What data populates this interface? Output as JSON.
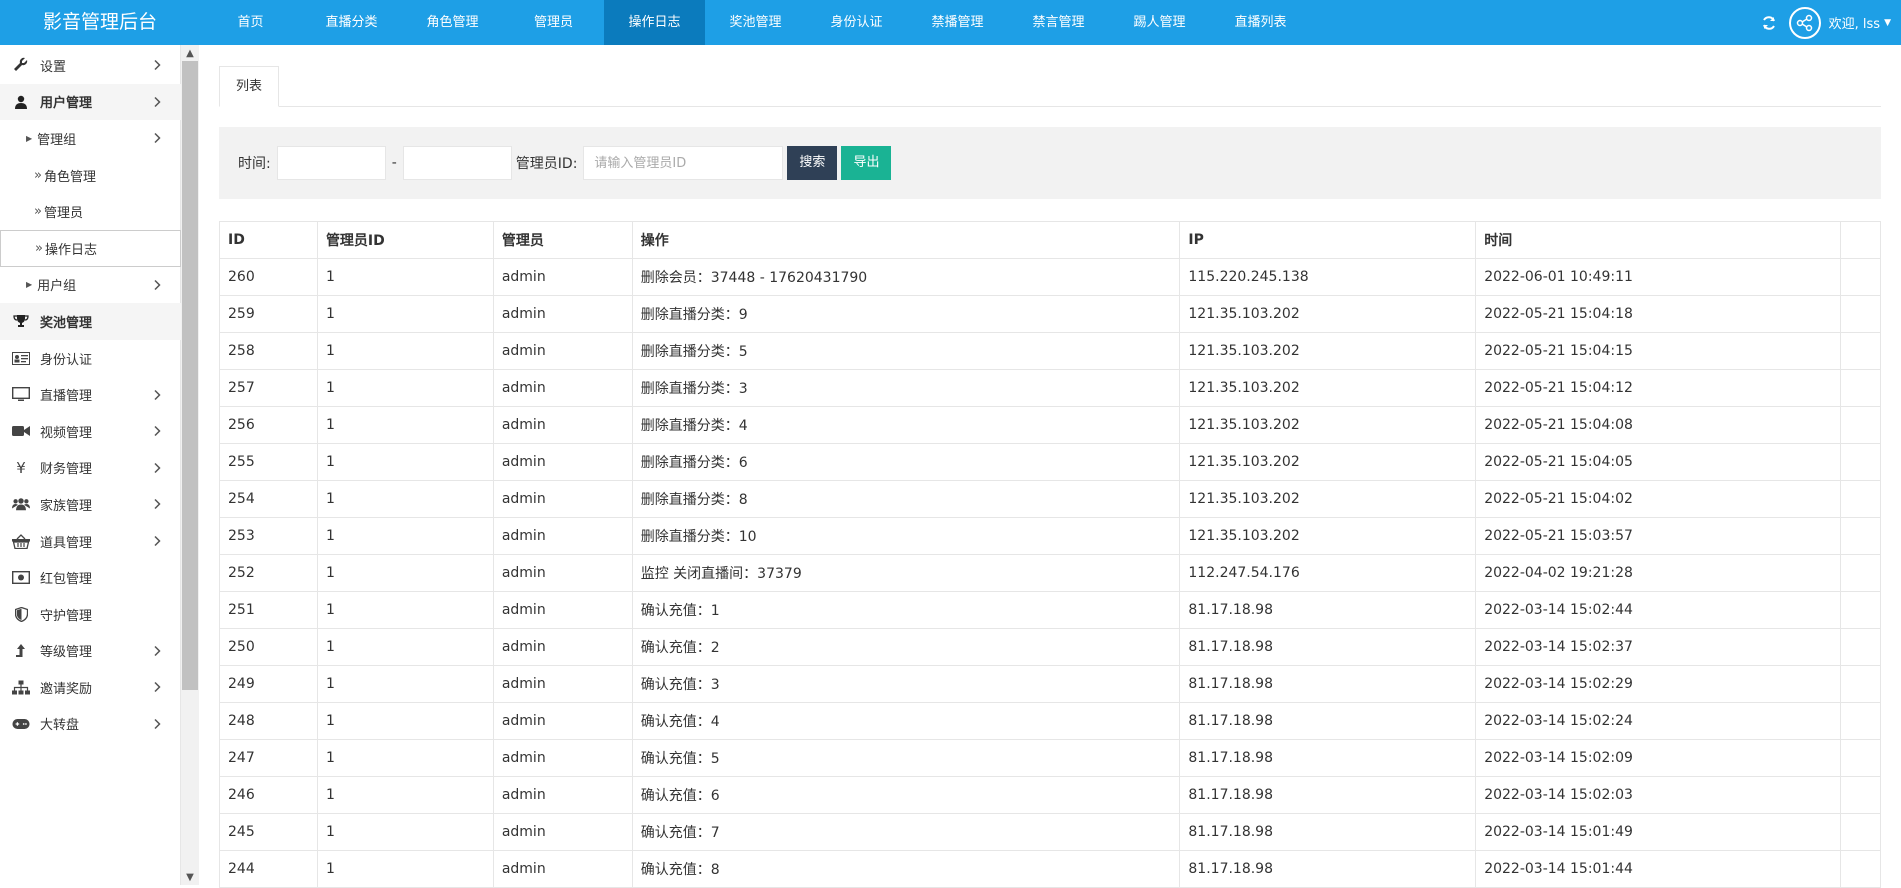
{
  "app": {
    "title": "影音管理后台"
  },
  "topnav": [
    {
      "label": "首页",
      "active": false
    },
    {
      "label": "直播分类",
      "active": false
    },
    {
      "label": "角色管理",
      "active": false
    },
    {
      "label": "管理员",
      "active": false
    },
    {
      "label": "操作日志",
      "active": true
    },
    {
      "label": "奖池管理",
      "active": false
    },
    {
      "label": "身份认证",
      "active": false
    },
    {
      "label": "禁播管理",
      "active": false
    },
    {
      "label": "禁言管理",
      "active": false
    },
    {
      "label": "踢人管理",
      "active": false
    },
    {
      "label": "直播列表",
      "active": false
    }
  ],
  "header": {
    "welcome": "欢迎, lss",
    "refresh_icon": "refresh-icon",
    "avatar_icon": "share-icon"
  },
  "colors": {
    "topbar": "#1e9fe6",
    "active_nav": "#0b7bbd",
    "search_btn": "#2f4056",
    "export_btn": "#1ab394"
  },
  "sidebar": [
    {
      "label": "设置",
      "icon": "wrench-icon",
      "arrow": true,
      "level": 0
    },
    {
      "label": "用户管理",
      "icon": "user-icon",
      "arrow": true,
      "level": 0,
      "bold": true
    },
    {
      "label": "管理组",
      "icon": "triangle",
      "arrow": true,
      "level": 1
    },
    {
      "label": "角色管理",
      "icon": "double-arrow",
      "arrow": false,
      "level": 2
    },
    {
      "label": "管理员",
      "icon": "double-arrow",
      "arrow": false,
      "level": 2
    },
    {
      "label": "操作日志",
      "icon": "double-arrow",
      "arrow": false,
      "level": 2,
      "selected": true
    },
    {
      "label": "用户组",
      "icon": "triangle",
      "arrow": true,
      "level": 1
    },
    {
      "label": "奖池管理",
      "icon": "trophy-icon",
      "arrow": false,
      "level": 0,
      "bold": true
    },
    {
      "label": "身份认证",
      "icon": "id-card-icon",
      "arrow": false,
      "level": 0
    },
    {
      "label": "直播管理",
      "icon": "monitor-icon",
      "arrow": true,
      "level": 0
    },
    {
      "label": "视频管理",
      "icon": "video-camera-icon",
      "arrow": true,
      "level": 0
    },
    {
      "label": "财务管理",
      "icon": "yen-icon",
      "arrow": true,
      "level": 0
    },
    {
      "label": "家族管理",
      "icon": "users-icon",
      "arrow": true,
      "level": 0
    },
    {
      "label": "道具管理",
      "icon": "basket-icon",
      "arrow": true,
      "level": 0
    },
    {
      "label": "红包管理",
      "icon": "money-icon",
      "arrow": false,
      "level": 0
    },
    {
      "label": "守护管理",
      "icon": "shield-icon",
      "arrow": false,
      "level": 0
    },
    {
      "label": "等级管理",
      "icon": "level-up-icon",
      "arrow": true,
      "level": 0
    },
    {
      "label": "邀请奖励",
      "icon": "sitemap-icon",
      "arrow": true,
      "level": 0
    },
    {
      "label": "大转盘",
      "icon": "gamepad-icon",
      "arrow": true,
      "level": 0
    }
  ],
  "tabs": {
    "list_label": "列表"
  },
  "filter": {
    "time_label": "时间:",
    "start_value": "",
    "separator": "-",
    "end_value": "",
    "admin_id_label": "管理员ID:",
    "admin_id_placeholder": "请输入管理员ID",
    "search_label": "搜索",
    "export_label": "导出"
  },
  "table": {
    "columns": [
      "ID",
      "管理员ID",
      "管理员",
      "操作",
      "IP",
      "时间",
      ""
    ],
    "rows": [
      [
        "260",
        "1",
        "admin",
        "删除会员：37448 - 17620431790",
        "115.220.245.138",
        "2022-06-01 10:49:11"
      ],
      [
        "259",
        "1",
        "admin",
        "删除直播分类：9",
        "121.35.103.202",
        "2022-05-21 15:04:18"
      ],
      [
        "258",
        "1",
        "admin",
        "删除直播分类：5",
        "121.35.103.202",
        "2022-05-21 15:04:15"
      ],
      [
        "257",
        "1",
        "admin",
        "删除直播分类：3",
        "121.35.103.202",
        "2022-05-21 15:04:12"
      ],
      [
        "256",
        "1",
        "admin",
        "删除直播分类：4",
        "121.35.103.202",
        "2022-05-21 15:04:08"
      ],
      [
        "255",
        "1",
        "admin",
        "删除直播分类：6",
        "121.35.103.202",
        "2022-05-21 15:04:05"
      ],
      [
        "254",
        "1",
        "admin",
        "删除直播分类：8",
        "121.35.103.202",
        "2022-05-21 15:04:02"
      ],
      [
        "253",
        "1",
        "admin",
        "删除直播分类：10",
        "121.35.103.202",
        "2022-05-21 15:03:57"
      ],
      [
        "252",
        "1",
        "admin",
        "监控 关闭直播间：37379",
        "112.247.54.176",
        "2022-04-02 19:21:28"
      ],
      [
        "251",
        "1",
        "admin",
        "确认充值：1",
        "81.17.18.98",
        "2022-03-14 15:02:44"
      ],
      [
        "250",
        "1",
        "admin",
        "确认充值：2",
        "81.17.18.98",
        "2022-03-14 15:02:37"
      ],
      [
        "249",
        "1",
        "admin",
        "确认充值：3",
        "81.17.18.98",
        "2022-03-14 15:02:29"
      ],
      [
        "248",
        "1",
        "admin",
        "确认充值：4",
        "81.17.18.98",
        "2022-03-14 15:02:24"
      ],
      [
        "247",
        "1",
        "admin",
        "确认充值：5",
        "81.17.18.98",
        "2022-03-14 15:02:09"
      ],
      [
        "246",
        "1",
        "admin",
        "确认充值：6",
        "81.17.18.98",
        "2022-03-14 15:02:03"
      ],
      [
        "245",
        "1",
        "admin",
        "确认充值：7",
        "81.17.18.98",
        "2022-03-14 15:01:49"
      ],
      [
        "244",
        "1",
        "admin",
        "确认充值：8",
        "81.17.18.98",
        "2022-03-14 15:01:44"
      ]
    ]
  }
}
